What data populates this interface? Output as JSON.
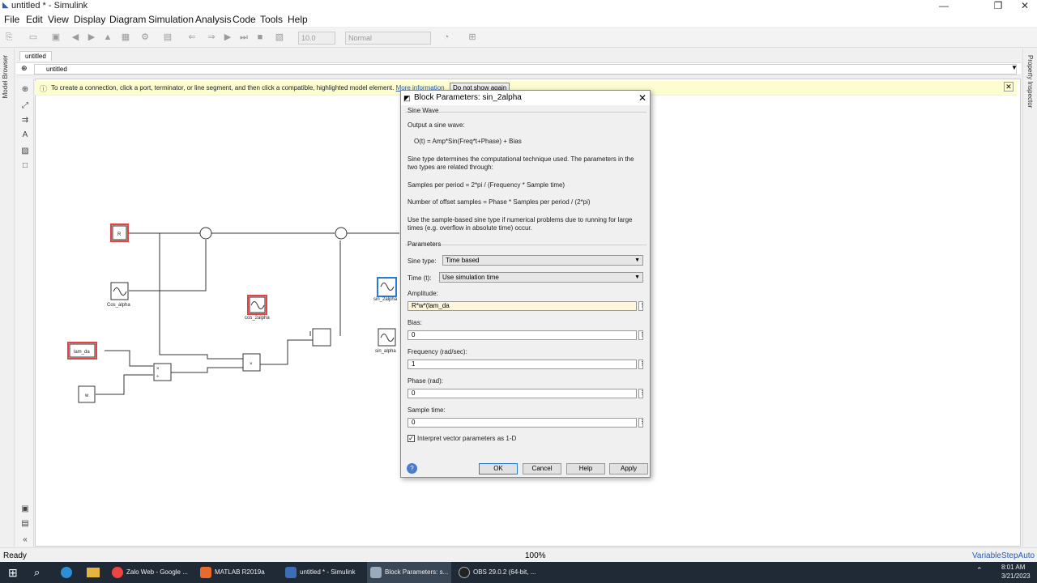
{
  "window": {
    "title": "untitled * - Simulink",
    "minimize": "—",
    "maximize": "❐",
    "close": "✕"
  },
  "menu": [
    "File",
    "Edit",
    "View",
    "Display",
    "Diagram",
    "Simulation",
    "Analysis",
    "Code",
    "Tools",
    "Help"
  ],
  "toolbar": {
    "stop_time": "10.0",
    "sim_mode": "Normal"
  },
  "tab": {
    "label": "untitled"
  },
  "address": {
    "path": "untitled"
  },
  "side": {
    "left": "Model Browser",
    "right": "Property Inspector"
  },
  "infobar": {
    "message": "To create a connection, click a port, terminator, or line segment, and then click a compatible, highlighted model element.",
    "link": "More information",
    "button": "Do not show again",
    "close": "✕"
  },
  "diagram": {
    "R": "R",
    "cos_alpha": "Cos_alpha",
    "cos_2alpha": "cos_2alpha",
    "lam_da": "lam_da",
    "w": "w",
    "sin_2alpha": "sin_2alpha",
    "sin_alpha": "sin_alpha",
    "times": "×",
    "div": "÷"
  },
  "dialog": {
    "title": "Block Parameters: sin_2alpha",
    "block_type": "Sine Wave",
    "desc1": "Output a sine wave:",
    "formula": "O(t) = Amp*Sin(Freq*t+Phase) + Bias",
    "desc2": "Sine type determines the computational technique used. The parameters in the two types are related through:",
    "formula2": "Samples per period = 2*pi / (Frequency * Sample time)",
    "formula3": "Number of offset samples = Phase * Samples per period / (2*pi)",
    "desc3": "Use the sample-based sine type if numerical problems due to running for large times (e.g. overflow in absolute time) occur.",
    "params_header": "Parameters",
    "sine_type_label": "Sine type:",
    "sine_type_value": "Time based",
    "time_label": "Time (t):",
    "time_value": "Use simulation time",
    "amplitude_label": "Amplitude:",
    "amplitude_value": "R*w*(lam_da",
    "bias_label": "Bias:",
    "bias_value": "0",
    "freq_label": "Frequency (rad/sec):",
    "freq_value": "1",
    "phase_label": "Phase (rad):",
    "phase_value": "0",
    "sample_label": "Sample time:",
    "sample_value": "0",
    "interpret_label": "Interpret vector parameters as 1-D",
    "ok": "OK",
    "cancel": "Cancel",
    "help": "Help",
    "apply": "Apply"
  },
  "status": {
    "left": "Ready",
    "zoom": "100%",
    "solver": "VariableStepAuto"
  },
  "taskbar": {
    "items": [
      "Zalo Web - Google ...",
      "MATLAB R2019a",
      "untitled * - Simulink",
      "Block Parameters: s...",
      "OBS 29.0.2 (64-bit, ..."
    ],
    "time": "8:01 AM",
    "date": "3/21/2023"
  }
}
